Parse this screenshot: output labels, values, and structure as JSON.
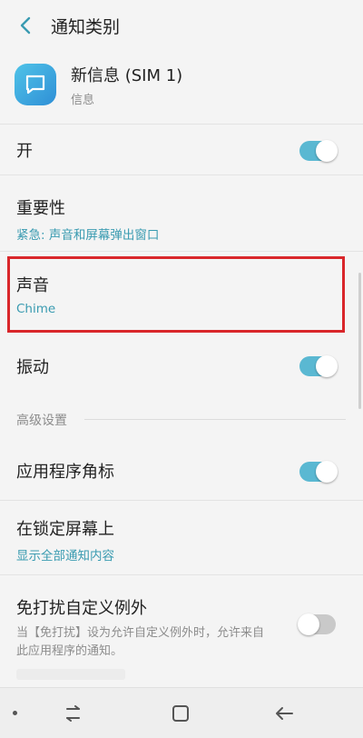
{
  "header": {
    "title": "通知类别",
    "back_icon": "chevron-left-icon"
  },
  "app": {
    "name": "新信息 (SIM 1)",
    "subtitle": "信息",
    "icon": "message-bubble-icon"
  },
  "settings": {
    "on": {
      "label": "开",
      "enabled": true
    },
    "importance": {
      "label": "重要性",
      "value": "紧急: 声音和屏幕弹出窗口"
    },
    "sound": {
      "label": "声音",
      "value": "Chime"
    },
    "vibration": {
      "label": "振动",
      "enabled": true
    },
    "advanced_section": "高级设置",
    "app_badge": {
      "label": "应用程序角标",
      "enabled": true
    },
    "lock_screen": {
      "label": "在锁定屏幕上",
      "value": "显示全部通知内容"
    },
    "dnd_exception": {
      "label": "免打扰自定义例外",
      "desc": "当【免打扰】设为允许自定义例外时，允许来自此应用程序的通知。",
      "enabled": false
    }
  },
  "colors": {
    "accent": "#5ab8d2",
    "highlight": "#d9262a",
    "link": "#3a9bb1"
  },
  "navbar": {
    "items": [
      "recents-icon",
      "home-icon",
      "back-arrow-icon"
    ]
  }
}
